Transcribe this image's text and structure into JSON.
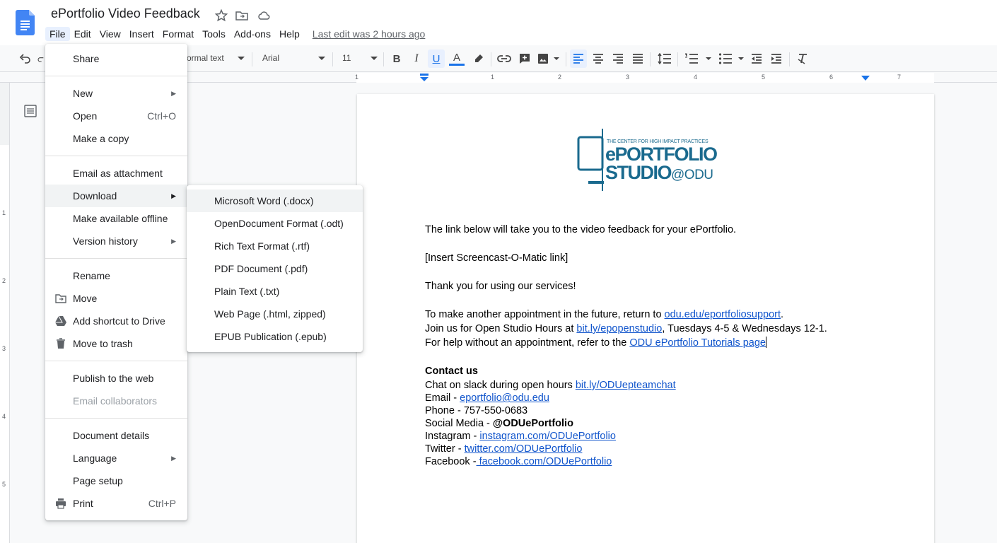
{
  "app": {
    "title": "ePortfolio Video Feedback",
    "last_edit": "Last edit was 2 hours ago"
  },
  "menubar": [
    "File",
    "Edit",
    "View",
    "Insert",
    "Format",
    "Tools",
    "Add-ons",
    "Help"
  ],
  "toolbar": {
    "style": "Normal text",
    "style_visible": "ormal text",
    "font": "Arial",
    "size": "11"
  },
  "ruler_numbers": [
    "1",
    "1",
    "2",
    "3",
    "4",
    "5",
    "6",
    "7"
  ],
  "vruler_numbers": [
    "1",
    "2",
    "3",
    "4",
    "5"
  ],
  "file_menu": {
    "share": "Share",
    "new": "New",
    "open": "Open",
    "open_shortcut": "Ctrl+O",
    "copy": "Make a copy",
    "email_attachment": "Email as attachment",
    "download": "Download",
    "offline": "Make available offline",
    "version_history": "Version history",
    "rename": "Rename",
    "move": "Move",
    "shortcut": "Add shortcut to Drive",
    "trash": "Move to trash",
    "publish": "Publish to the web",
    "email_collab": "Email collaborators",
    "details": "Document details",
    "language": "Language",
    "page_setup": "Page setup",
    "print": "Print",
    "print_shortcut": "Ctrl+P"
  },
  "download_menu": [
    "Microsoft Word (.docx)",
    "OpenDocument Format (.odt)",
    "Rich Text Format (.rtf)",
    "PDF Document (.pdf)",
    "Plain Text (.txt)",
    "Web Page (.html, zipped)",
    "EPUB Publication (.epub)"
  ],
  "logo": {
    "top_line": "THE CENTER FOR HIGH IMPACT PRACTICES",
    "line1": "ePORTFOLIO",
    "line2": "STUDIO",
    "line2_suffix": "@ODU"
  },
  "doc": {
    "p1": "The link below will take you to the video feedback for your ePortfolio.",
    "p2": "[Insert Screencast-O-Matic link]",
    "p3": "Thank you for using our services!",
    "p4a": "To make another appointment in the future, return to ",
    "p4_link": "odu.edu/eportfoliosupport",
    "p4b": ".",
    "p5a": "Join us for Open Studio Hours at ",
    "p5_link": "bit.ly/epopenstudio",
    "p5b": ", Tuesdays 4-5 & Wednesdays 12-1.",
    "p6a": "For help without an appointment, refer to the ",
    "p6_link": "ODU ePortfolio Tutorials page",
    "contact_heading": "Contact us",
    "slack_a": "Chat on slack during open hours ",
    "slack_link": "bit.ly/ODUepteamchat",
    "email_a": "Email - ",
    "email_link": "eportfolio@odu.edu",
    "phone": "Phone - 757-550-0683",
    "social_a": "Social Media - ",
    "social_b": "@ODUePortfolio",
    "insta_a": "Instagram - ",
    "insta_link": "instagram.com/ODUePortfolio",
    "twitter_a": "Twitter - ",
    "twitter_link": "twitter.com/ODUePortfolio",
    "fb_a": "Facebook -",
    "fb_link": " facebook.com/ODUePortfolio"
  },
  "colors": {
    "accent": "#1a73e8",
    "link": "#1155cc",
    "logo_blue": "#1a6a8e"
  }
}
